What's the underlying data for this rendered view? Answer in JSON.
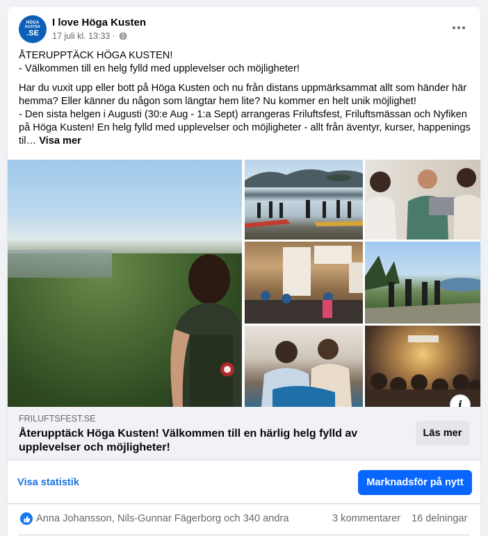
{
  "post": {
    "page_name": "I love Höga Kusten",
    "avatar_text": {
      "line1": "HÖGA",
      "line2": "KUSTEN",
      "line3": ".SE"
    },
    "date": "17 juli kl. 13:33",
    "separator": "·",
    "privacy_icon": "globe-icon",
    "more_icon": "more-options-icon"
  },
  "body": {
    "headline": "ÅTERUPPTÄCK HÖGA KUSTEN!",
    "subline": "- Välkommen till en helg fylld med upplevelser och möjligheter!",
    "paragraph": "Har du vuxit upp eller bott på Höga Kusten och nu från distans uppmärksammat allt som händer här hemma? Eller känner du någon som längtar hem lite? Nu kommer en helt unik möjlighet!",
    "paragraph2": "- Den sista helgen i Augusti (30:e Aug - 1:a Sept) arrangeras Friluftsfest, Friluftsmässan och Nyfiken på Höga Kusten! En helg fylld med upplevelser och möjligheter - allt från äventyr, kurser, happenings til…",
    "see_more": "Visa mer"
  },
  "media": {
    "info_icon": "info-icon",
    "info_label": "i",
    "images": [
      "hiker-overlooking-town-photo",
      "kayakers-on-shore-photo",
      "people-with-laptop-photo",
      "fair-hall-photo",
      "hikers-on-cliff-photo",
      "workshop-photo",
      "concert-audience-photo"
    ]
  },
  "link_preview": {
    "domain": "FRILUFTSFEST.SE",
    "title": "Återupptäck Höga Kusten! Välkommen till en härlig helg fylld av upplevelser och möjligheter!",
    "button": "Läs mer"
  },
  "actions": {
    "stats_link": "Visa statistik",
    "promote_button": "Marknadsför på nytt"
  },
  "reactions": {
    "like_icon": "thumbs-up-icon",
    "names": "Anna Johansson, Nils-Gunnar Fägerborg och 340 andra",
    "comments": "3 kommentarer",
    "shares": "16 delningar"
  },
  "colors": {
    "accent": "#0866ff",
    "link": "#1b74e4",
    "secondary_text": "#65676b",
    "avatar_bg": "#0b5fb4"
  }
}
